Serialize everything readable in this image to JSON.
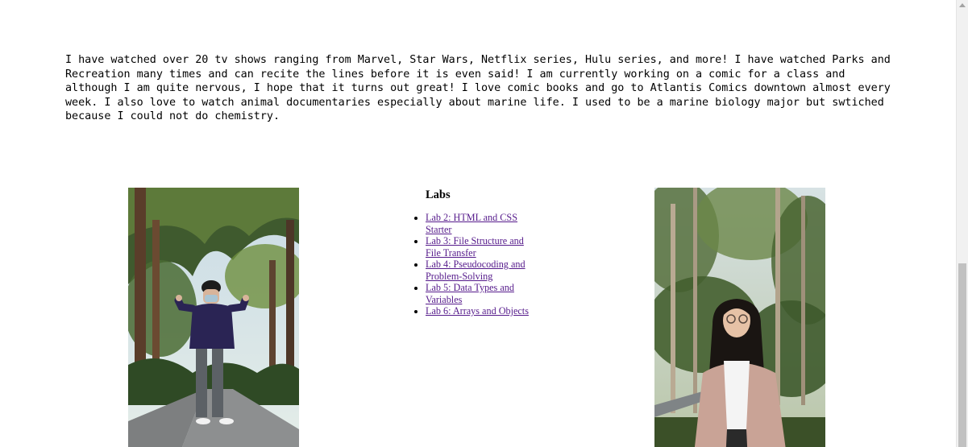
{
  "intro": {
    "text": "I have watched over 20 tv shows ranging from Marvel, Star Wars, Netflix series, Hulu series, and more! I have watched Parks and Recreation many times and can recite the lines before it is even said! I am currently working on a comic for a class and although I am quite nervous, I hope that it turns out great! I love comic books and go to Atlantis Comics downtown almost every week. I also love to watch animal documentaries especially about marine life. I used to be a marine biology major but swtiched because I could not do chemistry."
  },
  "labs": {
    "title": "Labs",
    "items": [
      {
        "label": "Lab 2: HTML and CSS Starter"
      },
      {
        "label": "Lab 3: File Structure and File Transfer"
      },
      {
        "label": "Lab 4: Pseudocoding and Problem-Solving"
      },
      {
        "label": "Lab 5: Data Types and Variables"
      },
      {
        "label": "Lab 6: Arrays and Objects"
      }
    ],
    "link_color": "#551a8b"
  },
  "photos": {
    "left": {
      "icon": "person-photo-forest-road"
    },
    "right": {
      "icon": "person-photo-forest-portrait"
    }
  }
}
